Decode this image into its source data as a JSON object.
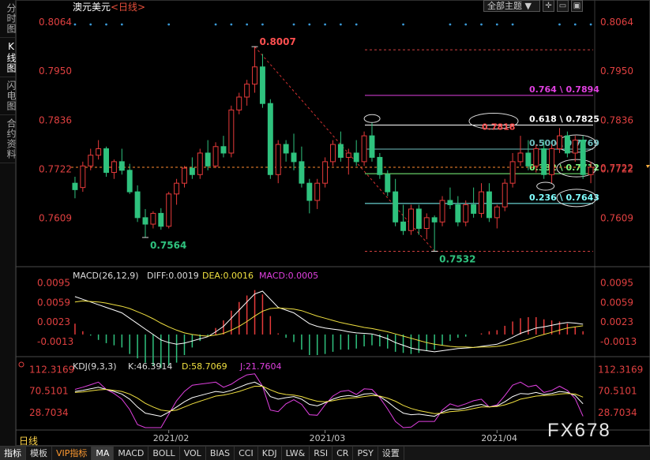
{
  "sidebar": {
    "items": [
      {
        "label": "分时图",
        "active": false
      },
      {
        "label": "K线图",
        "active": true
      },
      {
        "label": "闪电图",
        "active": false
      },
      {
        "label": "合约资料",
        "active": false
      }
    ]
  },
  "topbar": {
    "theme_select": "全部主题",
    "icons": [
      "chevron-down-icon",
      "crosshair-icon",
      "window-icon",
      "restore-icon"
    ]
  },
  "header": {
    "symbol": "澳元美元",
    "period_tag": "<日线>"
  },
  "watermark": "FX678",
  "period_label": "日线",
  "colors": {
    "up": "#e63a3a",
    "down": "#2fc27e",
    "diff": "#ffffff",
    "dea": "#f0e040",
    "j": "#e040e0",
    "fib_high": "#e040e0",
    "fib_618": "#ffffff",
    "fib_500": "#6fbfbf",
    "fib_382": "#80ff80",
    "fib_236": "#80ffff"
  },
  "chart_data": {
    "type": "candlestick",
    "title": "澳元美元<日线>",
    "y_ticks": [
      "0.8064",
      "0.7950",
      "0.7836",
      "0.7722",
      "0.7609"
    ],
    "ylim": [
      0.752,
      0.8075
    ],
    "x_ticks": [
      {
        "label": "2021/02",
        "index": 12
      },
      {
        "label": "2021/03",
        "index": 32
      },
      {
        "label": "2021/04",
        "index": 54
      }
    ],
    "current_price": 0.7727,
    "candles": [
      [
        0.769,
        0.7705,
        0.7655,
        0.7675
      ],
      [
        0.768,
        0.774,
        0.767,
        0.773
      ],
      [
        0.773,
        0.777,
        0.772,
        0.7755
      ],
      [
        0.7755,
        0.779,
        0.7745,
        0.777
      ],
      [
        0.777,
        0.7775,
        0.7705,
        0.7715
      ],
      [
        0.7715,
        0.7745,
        0.77,
        0.774
      ],
      [
        0.774,
        0.777,
        0.771,
        0.772
      ],
      [
        0.772,
        0.7735,
        0.7665,
        0.767
      ],
      [
        0.767,
        0.7685,
        0.76,
        0.761
      ],
      [
        0.761,
        0.763,
        0.7564,
        0.7595
      ],
      [
        0.7595,
        0.7625,
        0.7585,
        0.762
      ],
      [
        0.762,
        0.7632,
        0.7582,
        0.759
      ],
      [
        0.759,
        0.767,
        0.7585,
        0.7665
      ],
      [
        0.7665,
        0.77,
        0.764,
        0.769
      ],
      [
        0.769,
        0.773,
        0.768,
        0.7725
      ],
      [
        0.7725,
        0.775,
        0.77,
        0.771
      ],
      [
        0.771,
        0.777,
        0.77,
        0.776
      ],
      [
        0.776,
        0.779,
        0.772,
        0.773
      ],
      [
        0.773,
        0.7785,
        0.7725,
        0.7775
      ],
      [
        0.7775,
        0.78,
        0.775,
        0.776
      ],
      [
        0.776,
        0.787,
        0.775,
        0.786
      ],
      [
        0.786,
        0.79,
        0.785,
        0.789
      ],
      [
        0.789,
        0.793,
        0.787,
        0.792
      ],
      [
        0.792,
        0.8007,
        0.79,
        0.796
      ],
      [
        0.796,
        0.799,
        0.7865,
        0.7875
      ],
      [
        0.7875,
        0.7885,
        0.77,
        0.771
      ],
      [
        0.771,
        0.779,
        0.769,
        0.778
      ],
      [
        0.778,
        0.779,
        0.774,
        0.776
      ],
      [
        0.776,
        0.7805,
        0.772,
        0.774
      ],
      [
        0.774,
        0.7775,
        0.768,
        0.769
      ],
      [
        0.769,
        0.77,
        0.762,
        0.765
      ],
      [
        0.765,
        0.77,
        0.763,
        0.769
      ],
      [
        0.769,
        0.775,
        0.768,
        0.774
      ],
      [
        0.774,
        0.779,
        0.773,
        0.778
      ],
      [
        0.778,
        0.781,
        0.774,
        0.775
      ],
      [
        0.775,
        0.777,
        0.771,
        0.776
      ],
      [
        0.776,
        0.779,
        0.773,
        0.774
      ],
      [
        0.774,
        0.781,
        0.773,
        0.78
      ],
      [
        0.78,
        0.783,
        0.774,
        0.775
      ],
      [
        0.775,
        0.776,
        0.77,
        0.771
      ],
      [
        0.771,
        0.772,
        0.766,
        0.767
      ],
      [
        0.767,
        0.77,
        0.759,
        0.76
      ],
      [
        0.76,
        0.764,
        0.757,
        0.758
      ],
      [
        0.758,
        0.764,
        0.757,
        0.763
      ],
      [
        0.763,
        0.764,
        0.757,
        0.7585
      ],
      [
        0.7585,
        0.762,
        0.756,
        0.761
      ],
      [
        0.761,
        0.7615,
        0.7532,
        0.76
      ],
      [
        0.76,
        0.766,
        0.759,
        0.765
      ],
      [
        0.765,
        0.768,
        0.763,
        0.764
      ],
      [
        0.764,
        0.766,
        0.759,
        0.76
      ],
      [
        0.76,
        0.765,
        0.759,
        0.764
      ],
      [
        0.764,
        0.768,
        0.761,
        0.762
      ],
      [
        0.762,
        0.769,
        0.761,
        0.767
      ],
      [
        0.767,
        0.769,
        0.76,
        0.761
      ],
      [
        0.761,
        0.764,
        0.7585,
        0.7635
      ],
      [
        0.7635,
        0.77,
        0.7625,
        0.769
      ],
      [
        0.769,
        0.776,
        0.768,
        0.774
      ],
      [
        0.774,
        0.78,
        0.773,
        0.776
      ],
      [
        0.776,
        0.779,
        0.772,
        0.773
      ],
      [
        0.773,
        0.778,
        0.7715,
        0.777
      ],
      [
        0.777,
        0.779,
        0.77,
        0.771
      ],
      [
        0.771,
        0.778,
        0.769,
        0.777
      ],
      [
        0.777,
        0.7818,
        0.776,
        0.78
      ],
      [
        0.78,
        0.781,
        0.775,
        0.776
      ],
      [
        0.776,
        0.78,
        0.774,
        0.779
      ],
      [
        0.779,
        0.78,
        0.77,
        0.771
      ],
      [
        0.771,
        0.774,
        0.769,
        0.7727
      ]
    ],
    "annotations": [
      {
        "label": "0.8007",
        "price": 0.8007,
        "index": 23,
        "color": "#ff5050"
      },
      {
        "label": "0.7564",
        "price": 0.7564,
        "index": 9,
        "color": "#2fc27e"
      },
      {
        "label": "0.7532",
        "price": 0.7532,
        "index": 46,
        "color": "#2fc27e"
      }
    ],
    "fib_levels": [
      {
        "label": "0.764 \\ 0.7894",
        "value": 0.7894,
        "color": "#e040e0"
      },
      {
        "label": "0.618 \\ 0.7825",
        "value": 0.7825,
        "color": "#ffffff"
      },
      {
        "label": "0.500 \\ 0.7769",
        "value": 0.7769,
        "color": "#6fbfbf"
      },
      {
        "label": "0.382 \\ 0.7712",
        "value": 0.7712,
        "color": "#80ff80"
      },
      {
        "label": "0.236 \\ 0.7643",
        "value": 0.7643,
        "color": "#80ffff"
      }
    ],
    "fib_extra": {
      "top": 0.8007,
      "bottom": 0.7532
    },
    "price_callout": {
      "label": "0.7818",
      "value": 0.7818,
      "color": "#ff5050"
    },
    "macd": {
      "label": "MACD(26,12,9)",
      "diff_label": "DIFF:0.0019",
      "dea_label": "DEA:0.0016",
      "macd_label": "MACD:0.0005",
      "y_ticks": [
        "0.0095",
        "0.0059",
        "0.0023",
        "-0.0013"
      ],
      "ylim": [
        -0.0038,
        0.0115
      ],
      "diff": [
        0.007,
        0.0065,
        0.006,
        0.0055,
        0.005,
        0.0045,
        0.004,
        0.003,
        0.002,
        0.001,
        0.0,
        -0.001,
        -0.0015,
        -0.0018,
        -0.0016,
        -0.0012,
        -0.0008,
        -0.0004,
        0.0005,
        0.0015,
        0.003,
        0.0045,
        0.006,
        0.0075,
        0.008,
        0.0065,
        0.005,
        0.0045,
        0.004,
        0.003,
        0.002,
        0.0015,
        0.0012,
        0.001,
        0.0008,
        0.0005,
        0.0003,
        0.0002,
        0.0001,
        -0.0003,
        -0.0008,
        -0.0015,
        -0.002,
        -0.0025,
        -0.0028,
        -0.003,
        -0.0032,
        -0.003,
        -0.0028,
        -0.0026,
        -0.0025,
        -0.0024,
        -0.0022,
        -0.002,
        -0.0018,
        -0.0012,
        -0.0005,
        0.0002,
        0.0007,
        0.0012,
        0.0014,
        0.0017,
        0.002,
        0.0022,
        0.0021,
        0.0019
      ],
      "dea": [
        0.006,
        0.0062,
        0.0061,
        0.006,
        0.0058,
        0.0055,
        0.0052,
        0.0048,
        0.0042,
        0.0036,
        0.0029,
        0.0021,
        0.0014,
        0.0008,
        0.0003,
        0.0,
        -0.0002,
        -0.0003,
        -0.0001,
        0.0002,
        0.0008,
        0.0015,
        0.0024,
        0.0034,
        0.0043,
        0.0048,
        0.0049,
        0.0048,
        0.0047,
        0.0044,
        0.0039,
        0.0034,
        0.003,
        0.0026,
        0.0022,
        0.0019,
        0.0016,
        0.0013,
        0.0011,
        0.0008,
        0.0005,
        0.0001,
        -0.0003,
        -0.0007,
        -0.0011,
        -0.0015,
        -0.0018,
        -0.002,
        -0.0022,
        -0.0023,
        -0.0023,
        -0.0024,
        -0.0023,
        -0.0023,
        -0.0022,
        -0.002,
        -0.0017,
        -0.0013,
        -0.0009,
        -0.0004,
        0.0,
        0.0004,
        0.0008,
        0.0012,
        0.0014,
        0.0016
      ]
    },
    "kdj": {
      "label": "KDJ(9,3,3)",
      "k_label": "K:46.3914",
      "d_label": "D:58.7069",
      "j_label": "J:21.7604",
      "y_ticks": [
        "112.3169",
        "70.5101",
        "28.7034"
      ],
      "ylim": [
        0,
        125
      ],
      "k": [
        70,
        72,
        75,
        78,
        74,
        70,
        65,
        55,
        40,
        28,
        25,
        22,
        30,
        40,
        50,
        58,
        62,
        66,
        70,
        68,
        72,
        78,
        84,
        88,
        80,
        60,
        55,
        58,
        60,
        55,
        45,
        42,
        48,
        55,
        60,
        62,
        60,
        65,
        66,
        60,
        50,
        38,
        28,
        25,
        26,
        24,
        22,
        30,
        36,
        35,
        38,
        42,
        45,
        40,
        42,
        50,
        60,
        66,
        65,
        68,
        64,
        66,
        70,
        68,
        62,
        46
      ],
      "d": [
        68,
        69,
        71,
        73,
        74,
        72,
        70,
        65,
        57,
        47,
        40,
        34,
        32,
        34,
        40,
        46,
        51,
        56,
        61,
        63,
        66,
        70,
        75,
        80,
        80,
        73,
        67,
        64,
        63,
        60,
        55,
        51,
        50,
        52,
        55,
        57,
        58,
        60,
        62,
        61,
        57,
        51,
        43,
        37,
        33,
        30,
        27,
        28,
        31,
        32,
        34,
        37,
        40,
        40,
        41,
        44,
        49,
        55,
        58,
        61,
        62,
        63,
        65,
        66,
        65,
        59
      ],
      "j": [
        74,
        78,
        83,
        88,
        74,
        66,
        55,
        35,
        6,
        -10,
        -5,
        -2,
        26,
        52,
        70,
        82,
        84,
        86,
        88,
        78,
        84,
        94,
        102,
        104,
        80,
        34,
        31,
        46,
        54,
        45,
        25,
        24,
        44,
        61,
        70,
        72,
        64,
        75,
        74,
        58,
        36,
        12,
        -2,
        1,
        12,
        12,
        12,
        34,
        46,
        41,
        46,
        52,
        55,
        40,
        44,
        62,
        82,
        88,
        79,
        82,
        68,
        72,
        80,
        72,
        56,
        22
      ]
    }
  }
}
